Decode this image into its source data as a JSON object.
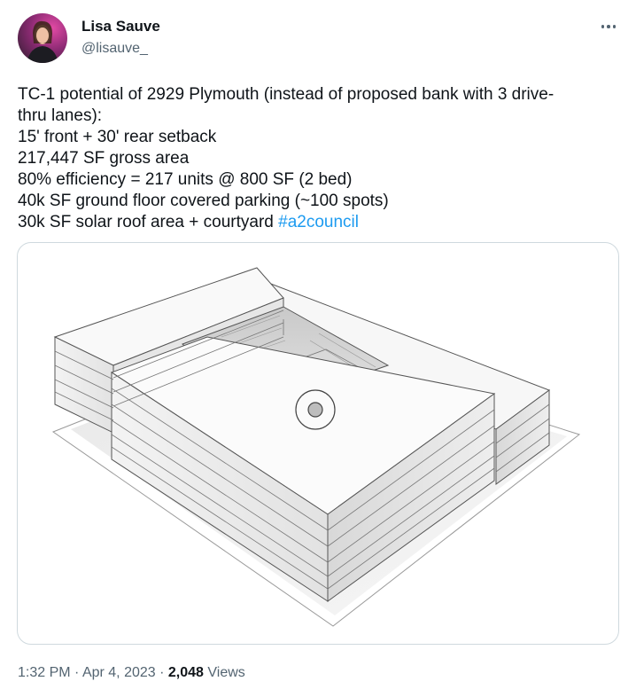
{
  "author": {
    "display_name": "Lisa Sauve",
    "handle": "@lisauve_",
    "avatar_icon": "profile-photo"
  },
  "more_icon": "more-horizontal-icon",
  "tweet": {
    "lines": [
      "TC-1 potential of 2929 Plymouth (instead of proposed bank with 3 drive-",
      "thru lanes):",
      "15' front + 30' rear setback",
      "217,447 SF gross area",
      "80% efficiency = 217 units @ 800 SF (2 bed)",
      "40k SF ground floor covered parking (~100 spots)",
      "30k SF solar roof area + courtyard "
    ],
    "hashtag": "#a2council"
  },
  "media": {
    "kind": "3D massing model rendering"
  },
  "meta": {
    "time": "1:32 PM",
    "separator": "·",
    "date": "Apr 4, 2023",
    "views_count": "2,048",
    "views_label": "Views"
  },
  "colors": {
    "text": "#0f1419",
    "secondary": "#536471",
    "link": "#1d9bf0",
    "border": "#cfd9de"
  }
}
